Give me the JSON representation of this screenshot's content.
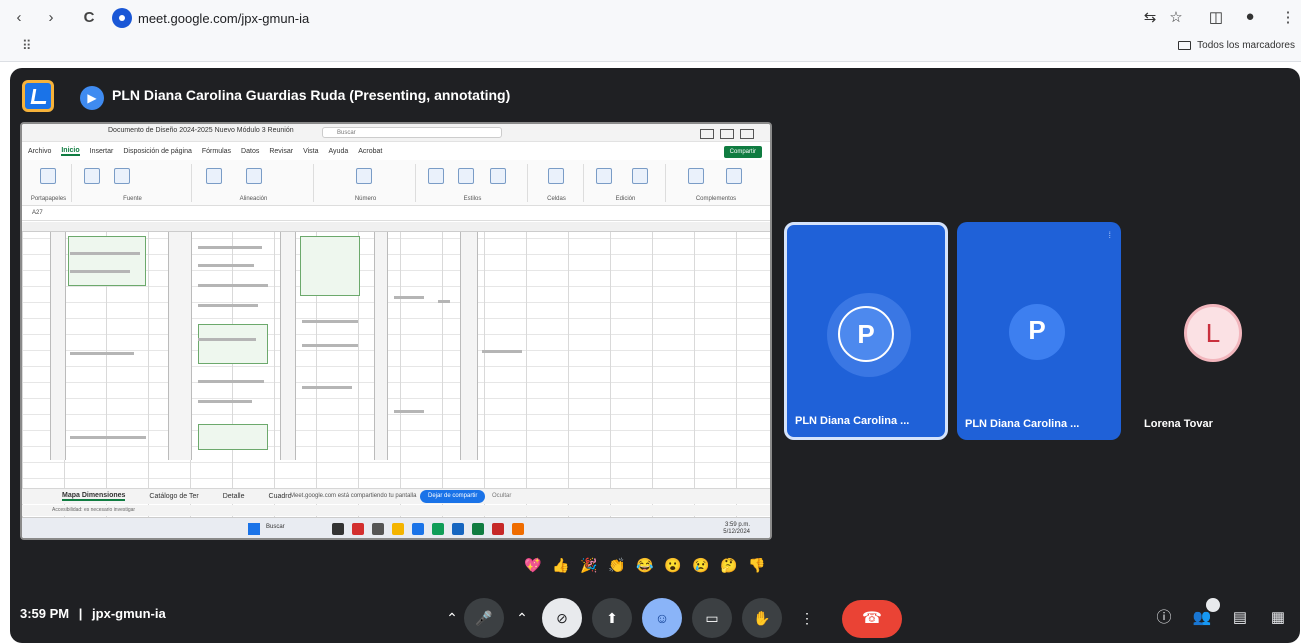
{
  "browser": {
    "nav": {
      "back": "‹",
      "forward": "›",
      "reload": "C"
    },
    "url": "meet.google.com/jpx-gmun-ia",
    "bookmarks_label": "Todos los marcadores"
  },
  "presentation": {
    "presenter_label": "PLN Diana Carolina Guardias Ruda (Presenting, annotating)"
  },
  "shared_screen": {
    "excel": {
      "title": "Documento de Diseño 2024-2025 Nuevo Módulo 3 Reunión",
      "search_placeholder": "Buscar",
      "menu": [
        "Archivo",
        "Inicio",
        "Insertar",
        "Disposición de página",
        "Fórmulas",
        "Datos",
        "Revisar",
        "Vista",
        "Ayuda",
        "Acrobat"
      ],
      "share_label": "Compartir",
      "ribbon_groups": [
        "Portapapeles",
        "Fuente",
        "Alineación",
        "Número",
        "Estilos",
        "Celdas",
        "Edición",
        "Complementos"
      ],
      "cell_ref": "A27",
      "sheets": [
        "Mapa Dimensiones",
        "Catálogo de Ter",
        "Detalle",
        "Cuadro"
      ],
      "share_message": "Meet.google.com está compartiendo tu pantalla",
      "stop_share_label": "Dejar de compartir",
      "ignore_label": "Ocultar",
      "status_text": "Accesibilidad: es necesario investigar",
      "taskbar_search": "Buscar",
      "tray_time": "3:59 p.m.",
      "tray_date": "5/12/2024"
    }
  },
  "participants": [
    {
      "initial": "P",
      "name": "PLN Diana Carolina ...",
      "color": "#1f61d8"
    },
    {
      "initial": "P",
      "name": "PLN Diana Carolina ...",
      "color": "#1f61d8"
    },
    {
      "initial": "L",
      "name": "Lorena Tovar",
      "color": "#fbe1e4"
    }
  ],
  "reactions": [
    "💖",
    "👍",
    "🎉",
    "👏",
    "😂",
    "😮",
    "😢",
    "🤔",
    "👎"
  ],
  "meeting": {
    "time": "3:59 PM",
    "separator": "|",
    "code": "jpx-gmun-ia"
  },
  "controls": [
    {
      "name": "expand-more-icon",
      "glyph": "⌃"
    },
    {
      "name": "mic-icon",
      "glyph": "🎤"
    },
    {
      "name": "more-options-icon",
      "glyph": "⌃"
    },
    {
      "name": "camera-off-icon",
      "glyph": "⊘"
    },
    {
      "name": "present-icon",
      "glyph": "⬆"
    },
    {
      "name": "emoji-icon",
      "glyph": "☺"
    },
    {
      "name": "captions-icon",
      "glyph": "▭"
    },
    {
      "name": "raise-hand-icon",
      "glyph": "✋"
    },
    {
      "name": "more-vert-icon",
      "glyph": "⋮"
    },
    {
      "name": "end-call-icon",
      "glyph": "☎"
    }
  ],
  "right_controls": [
    "info-icon",
    "people-icon",
    "chat-icon",
    "activities-icon"
  ],
  "colors": {
    "stage_bg": "#1f2023",
    "tile_blue": "#1f61d8",
    "end_call": "#ea4335",
    "accent": "#8ab4f8"
  }
}
